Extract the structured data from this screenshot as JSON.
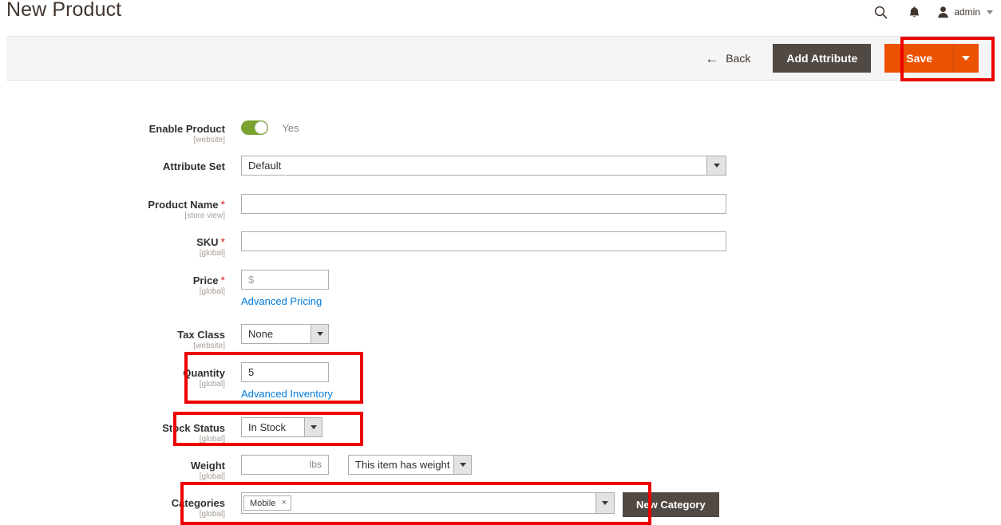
{
  "header": {
    "title": "New Product",
    "search_icon": "search-icon",
    "notifications_icon": "bell-icon",
    "user_icon": "user-avatar-icon",
    "admin_label": "admin"
  },
  "toolbar": {
    "back_label": "Back",
    "back_icon": "arrow-left-icon",
    "add_attribute_label": "Add Attribute",
    "save_label": "Save",
    "save_dropdown_icon": "chevron-down-icon",
    "save_color": "#eb5202",
    "add_attribute_color": "#514943"
  },
  "highlights": {
    "color": "#ec0000",
    "targets": [
      "save-button",
      "quantity-field",
      "stock-status-field",
      "categories-field"
    ]
  },
  "form": {
    "enable_product": {
      "label": "Enable Product",
      "scope": "[website]",
      "value": "Yes",
      "toggle_on": true,
      "toggle_color": "#79a22e"
    },
    "attribute_set": {
      "label": "Attribute Set",
      "scope": "",
      "value": "Default"
    },
    "product_name": {
      "label": "Product Name",
      "scope": "[store view]",
      "required": "*",
      "value": "",
      "placeholder": ""
    },
    "sku": {
      "label": "SKU",
      "scope": "[global]",
      "required": "*",
      "value": "",
      "placeholder": ""
    },
    "price": {
      "label": "Price",
      "scope": "[global]",
      "required": "*",
      "value": "",
      "placeholder": "$",
      "link_label": "Advanced Pricing"
    },
    "tax_class": {
      "label": "Tax Class",
      "scope": "[website]",
      "value": "None"
    },
    "quantity": {
      "label": "Quantity",
      "scope": "[global]",
      "value": "5",
      "link_label": "Advanced Inventory"
    },
    "stock_status": {
      "label": "Stock Status",
      "scope": "[global]",
      "value": "In Stock"
    },
    "weight": {
      "label": "Weight",
      "scope": "[global]",
      "value": "",
      "unit": "lbs",
      "has_weight_value": "This item has weight"
    },
    "categories": {
      "label": "Categories",
      "scope": "[global]",
      "chips": [
        {
          "label": "Mobile",
          "remove_icon": "×"
        }
      ],
      "new_category_label": "New Category"
    }
  }
}
